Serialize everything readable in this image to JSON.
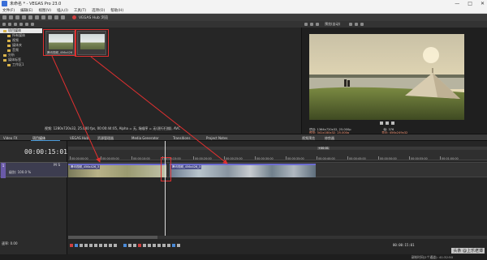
{
  "window": {
    "title": "未命名 * - VEGAS Pro 23.0",
    "controls": [
      "—",
      "□",
      "✕"
    ]
  },
  "menu": [
    "文件(F)",
    "编辑(E)",
    "视图(V)",
    "插入(I)",
    "工具(T)",
    "选项(O)",
    "帮助(H)"
  ],
  "toolbar": {
    "hub_label": "VEGAS Hub 浏览"
  },
  "explorer": {
    "tree": [
      {
        "label": "项目媒体",
        "selected": true
      },
      {
        "label": "所有媒体",
        "sub": true
      },
      {
        "label": "视频",
        "sub": true
      },
      {
        "label": "媒体夹",
        "sub": true
      },
      {
        "label": "音频",
        "sub": true
      },
      {
        "label": "分析"
      },
      {
        "label": "媒体标签"
      },
      {
        "label": "工作区1"
      }
    ],
    "thumb1_caption": "腾讯视频_456x426",
    "file_info": "视频: 1280x720x32, 25.000 fps, 00:00:44:05, Alpha = 无, 场顺序 = 无(逐行扫描), AVC"
  },
  "preview": {
    "mode": "预览(自动)",
    "info": {
      "project": "项目: 1364x720x32, 25.000p",
      "preview": "预览: 341x180x32, 25.000p",
      "display": "显示: 456x249x32",
      "frame": "帧: 376"
    }
  },
  "tabs": [
    "Video FX",
    "项目媒体",
    "VEGAS Hub",
    "资源管理器",
    "Media Generator",
    "Transitions",
    "Project Notes",
    "视频预览",
    "修剪器"
  ],
  "timeline": {
    "timecode": "00:00:15:01",
    "track_number": "1",
    "track_level": "级别: 100.0 %",
    "track_ms": "M  S",
    "rate": "速率: 0.00",
    "ruler_marker": "+00:01",
    "ruler_labels": [
      "00:00:00:00",
      "00:00:05:00",
      "00:00:10:00",
      "00:00:15:00",
      "00:00:20:00",
      "00:00:25:00",
      "00:00:30:00",
      "00:00:35:00",
      "00:00:40:00",
      "00:00:45:00",
      "00:00:50:00",
      "00:00:55:00",
      "00:01:00:00"
    ],
    "clip1_label": "腾讯视频_456x426_3",
    "clip2_label": "腾讯视频_456x426_3",
    "end_time": "00:00:15:01",
    "status_right": "录制时间(2个通道): 41:32:50"
  },
  "watermark": "头条 @上乐老谭"
}
